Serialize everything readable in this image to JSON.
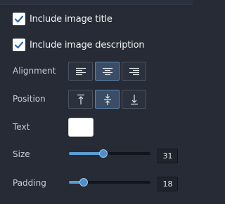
{
  "include_title": {
    "label": "Include image title",
    "checked": true
  },
  "include_description": {
    "label": "Include image description",
    "checked": true
  },
  "alignment": {
    "label": "Alignment",
    "options": [
      "left",
      "center",
      "right"
    ],
    "selected": "center"
  },
  "position": {
    "label": "Position",
    "options": [
      "top",
      "middle",
      "bottom"
    ],
    "selected": "middle"
  },
  "text": {
    "label": "Text",
    "color": "#ffffff"
  },
  "size": {
    "label": "Size",
    "value": "31",
    "slider_fraction": 0.42
  },
  "padding": {
    "label": "Padding",
    "value": "18",
    "slider_fraction": 0.18
  },
  "colors": {
    "accent": "#5b9fd6",
    "background": "#262b35"
  }
}
